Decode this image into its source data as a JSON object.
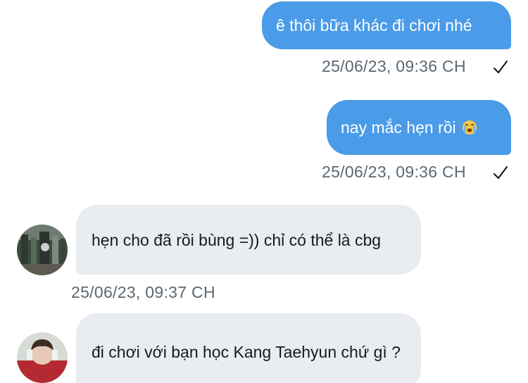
{
  "messages": [
    {
      "direction": "out",
      "text": "ê thôi bữa khác đi chơi nhé",
      "time": "25/06/23, 09:36 CH",
      "status_icon": "checkmark-icon"
    },
    {
      "direction": "out",
      "text": "nay mắc hẹn rồi",
      "emoji": "loudly-crying-face-emoji",
      "time": "25/06/23, 09:36 CH",
      "status_icon": "checkmark-icon"
    },
    {
      "direction": "in",
      "text": "hẹn cho đã rồi bùng =)) chỉ có thể là cbg",
      "time": "25/06/23, 09:37 CH",
      "avatar_icon": "avatar-photo-shop"
    },
    {
      "direction": "in",
      "text": "đi chơi với bạn học Kang Taehyun chứ gì ?",
      "avatar_icon": "avatar-photo-person"
    }
  ],
  "colors": {
    "outgoing_bubble": "#4a9be8",
    "incoming_bubble": "#e9ecf0",
    "timestamp": "#5b6874",
    "background": "#ffffff"
  }
}
